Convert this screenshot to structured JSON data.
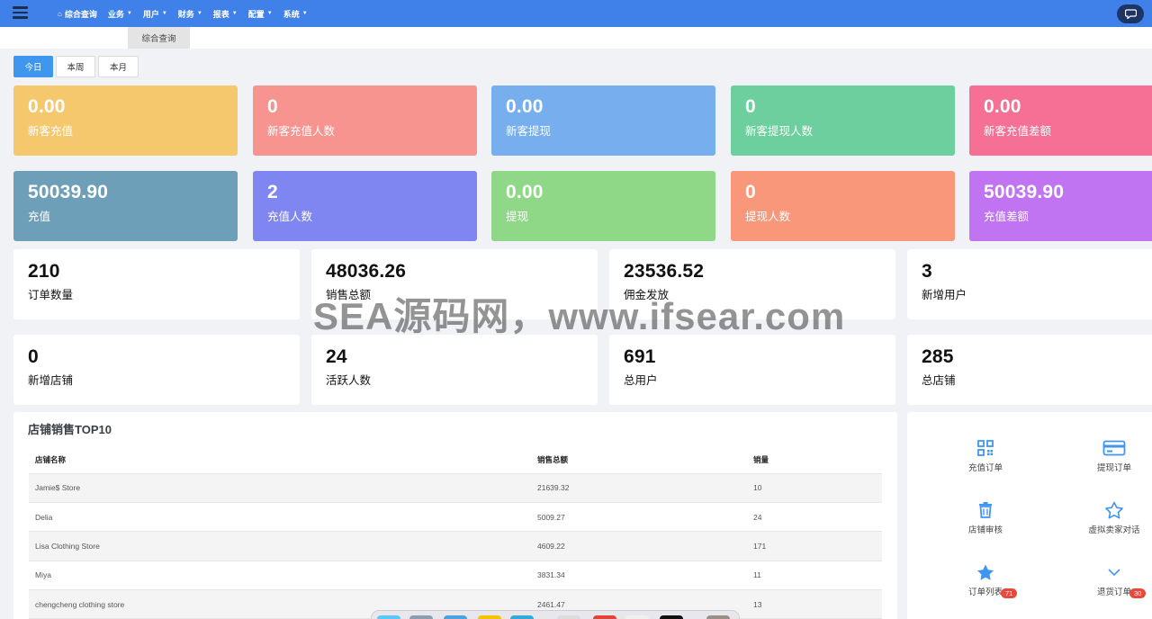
{
  "nav": {
    "items": [
      {
        "label": "综合查询",
        "icon": "home-icon",
        "dropdown": false
      },
      {
        "label": "业务",
        "dropdown": true
      },
      {
        "label": "用户",
        "dropdown": true
      },
      {
        "label": "财务",
        "dropdown": true
      },
      {
        "label": "报表",
        "dropdown": true
      },
      {
        "label": "配置",
        "dropdown": true
      },
      {
        "label": "系统",
        "dropdown": true
      }
    ],
    "accent": "#3f80e9"
  },
  "tab": {
    "label": "综合查询"
  },
  "periods": {
    "today": "今日",
    "week": "本周",
    "month": "本月",
    "active": "today"
  },
  "cards_row1": [
    {
      "value": "0.00",
      "label": "新客充值",
      "color": "#f6c86e"
    },
    {
      "value": "0",
      "label": "新客充值人数",
      "color": "#f7948f"
    },
    {
      "value": "0.00",
      "label": "新客提现",
      "color": "#76aeee"
    },
    {
      "value": "0",
      "label": "新客提现人数",
      "color": "#6dcf9d"
    },
    {
      "value": "0.00",
      "label": "新客充值差额",
      "color": "#f66f94"
    }
  ],
  "cards_row2": [
    {
      "value": "50039.90",
      "label": "充值",
      "color": "#6e9fb9"
    },
    {
      "value": "2",
      "label": "充值人数",
      "color": "#7f86f2"
    },
    {
      "value": "0.00",
      "label": "提现",
      "color": "#8fd888"
    },
    {
      "value": "0",
      "label": "提现人数",
      "color": "#f8977a"
    },
    {
      "value": "50039.90",
      "label": "充值差额",
      "color": "#c074f1"
    }
  ],
  "cards_row3": [
    {
      "value": "210",
      "label": "订单数量"
    },
    {
      "value": "48036.26",
      "label": "销售总额"
    },
    {
      "value": "23536.52",
      "label": "佣金发放"
    },
    {
      "value": "3",
      "label": "新增用户"
    }
  ],
  "cards_row4": [
    {
      "value": "0",
      "label": "新增店铺"
    },
    {
      "value": "24",
      "label": "活跃人数"
    },
    {
      "value": "691",
      "label": "总用户"
    },
    {
      "value": "285",
      "label": "总店铺"
    }
  ],
  "top10": {
    "title": "店铺销售TOP10",
    "headers": [
      "店铺名称",
      "销售总额",
      "销量"
    ],
    "rows": [
      [
        "Jamie$ Store",
        "21639.32",
        "10"
      ],
      [
        "Delia",
        "5009.27",
        "24"
      ],
      [
        "Lisa Clothing Store",
        "4609.22",
        "171"
      ],
      [
        "Miya",
        "3831.34",
        "11"
      ],
      [
        "chengcheng clothing store",
        "2461.47",
        "13"
      ]
    ]
  },
  "shortcuts": [
    {
      "label": "充值订单",
      "icon": "qrcode-icon"
    },
    {
      "label": "提现订单",
      "icon": "credit-card-icon"
    },
    {
      "label": "店铺审核",
      "icon": "trash-icon"
    },
    {
      "label": "虚拟卖家对话",
      "icon": "star-outline-icon"
    },
    {
      "label": "订单列表",
      "icon": "star-icon",
      "badge": "71"
    },
    {
      "label": "退货订单",
      "icon": "chevron-down-icon",
      "badge": "30"
    }
  ],
  "watermark": "SEA源码网，www.ifsear.com"
}
